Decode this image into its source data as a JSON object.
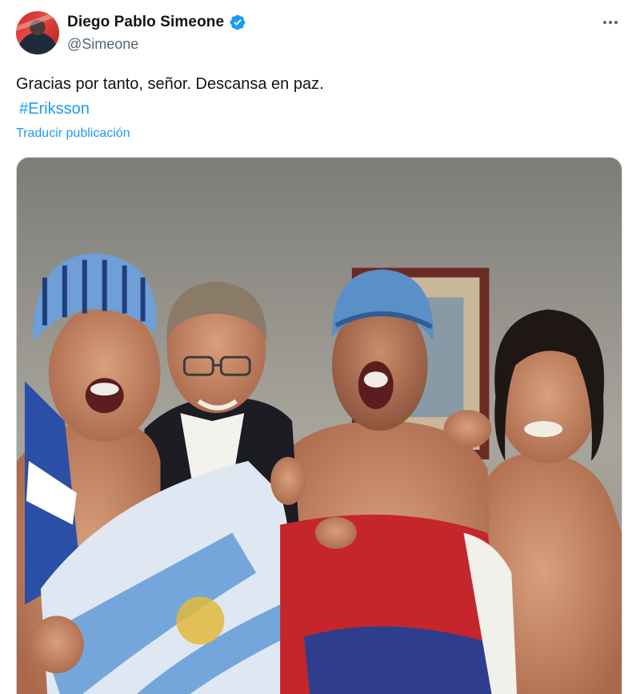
{
  "author": {
    "display_name": "Diego Pablo Simeone",
    "handle": "@Simeone",
    "verified": true
  },
  "tweet": {
    "text": "Gracias por tanto, señor. Descansa en paz.",
    "hashtag": "#Eriksson",
    "translate_label": "Traducir publicación"
  },
  "icons": {
    "verified": "verified-badge-icon",
    "more": "more-options-icon"
  },
  "colors": {
    "link": "#1d9bf0",
    "secondary_text": "#536471",
    "primary_text": "#0f1419"
  }
}
